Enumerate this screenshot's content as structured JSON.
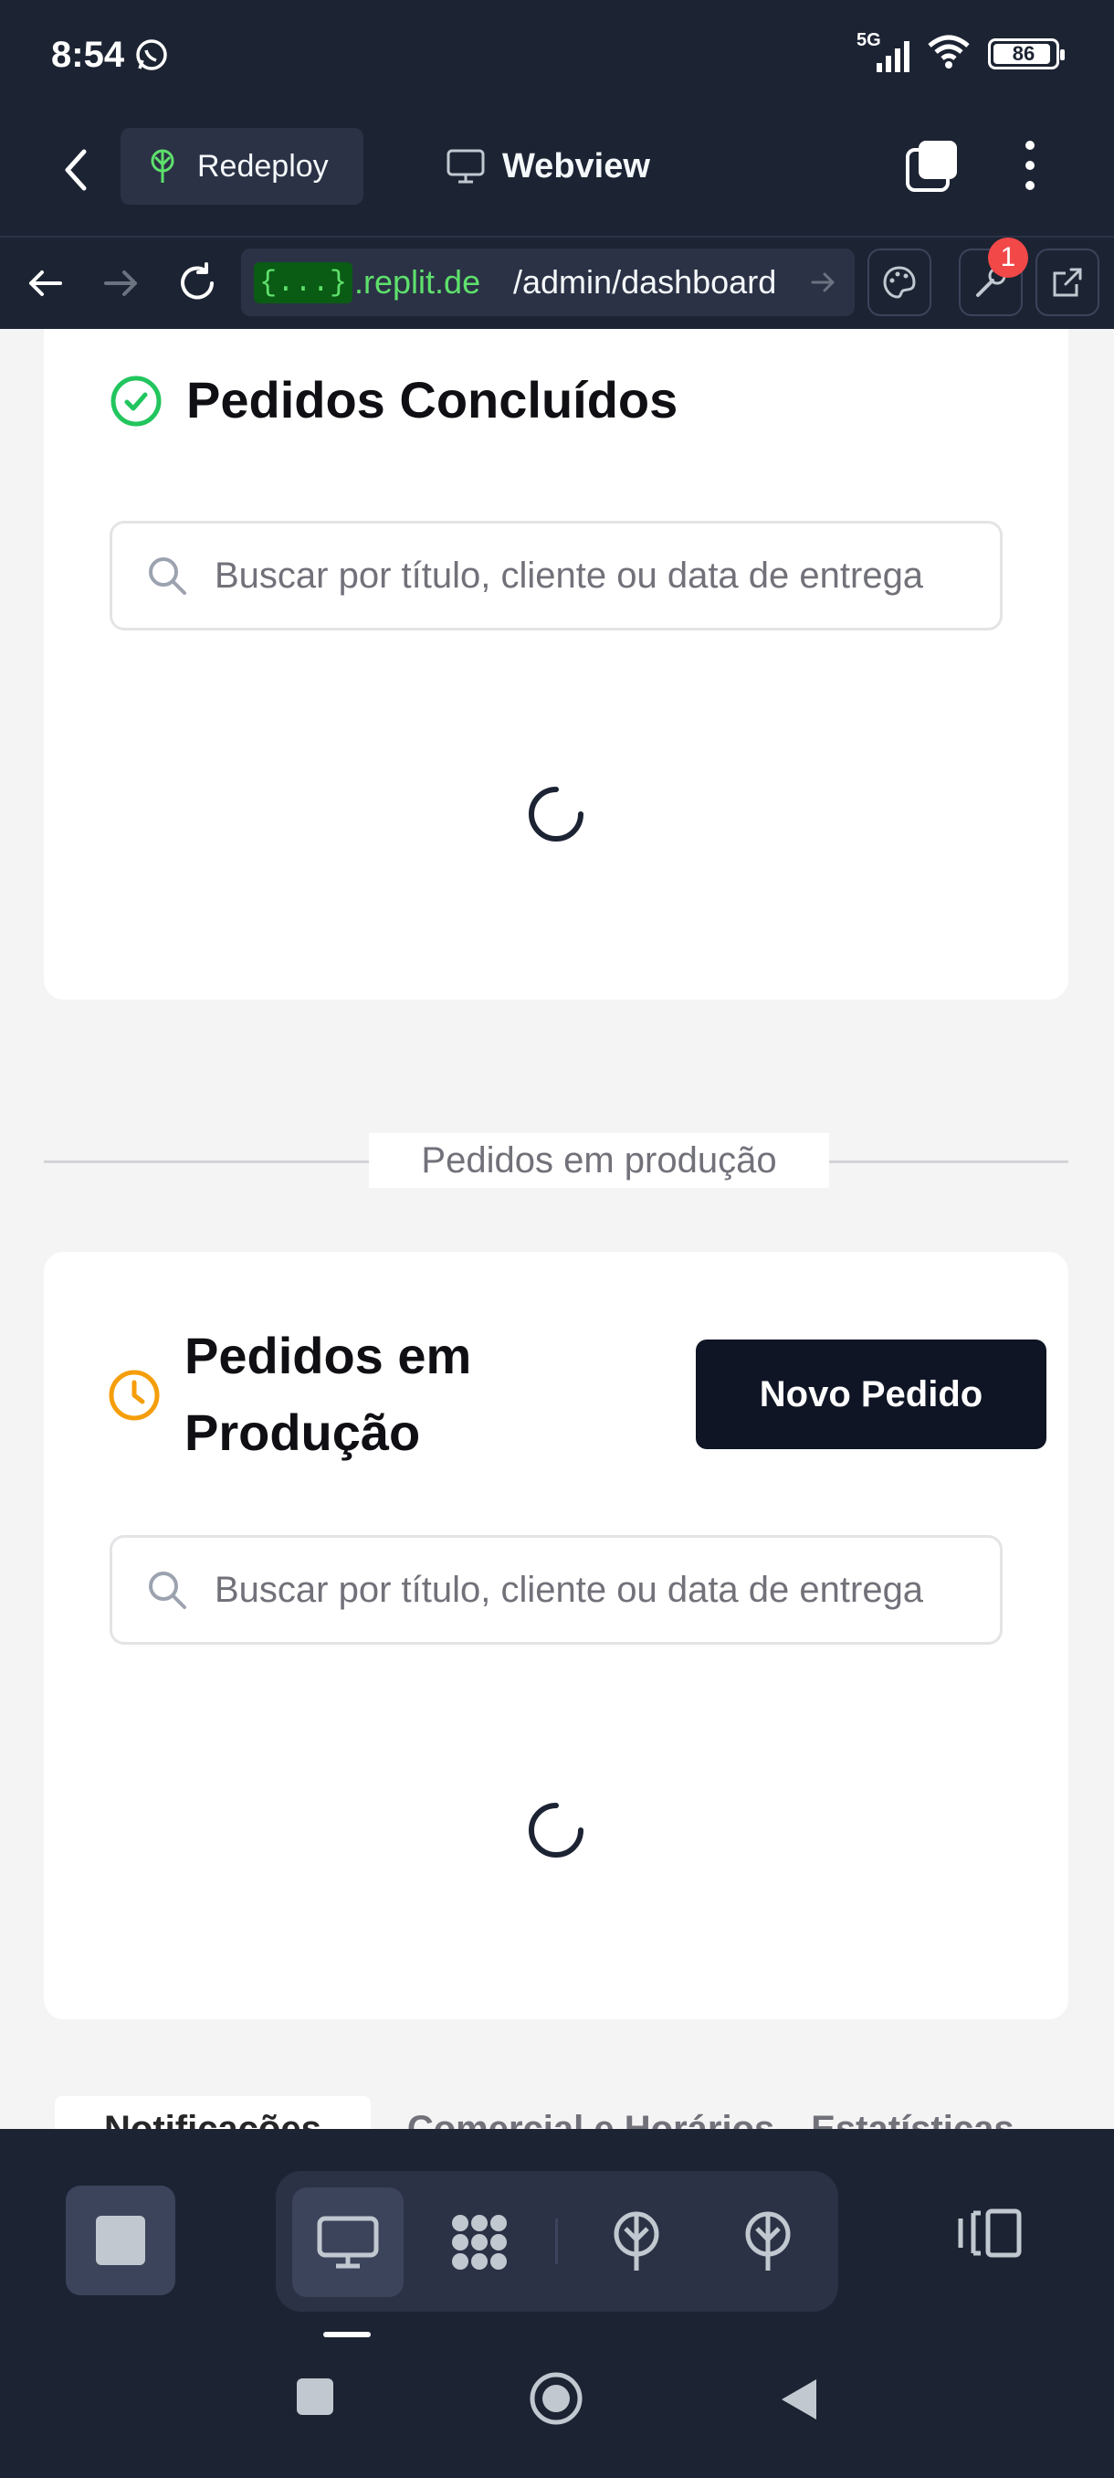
{
  "status_bar": {
    "time": "8:54",
    "network": "5G",
    "battery": "86"
  },
  "top_bar": {
    "redeploy_label": "Redeploy",
    "webview_label": "Webview"
  },
  "url_bar": {
    "chip": "{...}",
    "host": ".replit.de",
    "path": "/admin/dashboard",
    "devtools_badge": "1"
  },
  "completed_card": {
    "title": "Pedidos Concluídos",
    "search_placeholder": "Buscar por título, cliente ou data de entrega"
  },
  "divider": {
    "label": "Pedidos em produção"
  },
  "production_card": {
    "title_line1": "Pedidos em",
    "title_line2": "Produção",
    "new_order_label": "Novo Pedido",
    "search_placeholder": "Buscar por título, cliente ou data de entrega"
  },
  "bottom_tabs": [
    "Notificações",
    "Comercial e Horários",
    "Estatísticas"
  ],
  "colors": {
    "accent_green": "#22c55e",
    "accent_orange": "#f59e0b",
    "dark": "#1c2333",
    "button_dark": "#0f1525"
  }
}
